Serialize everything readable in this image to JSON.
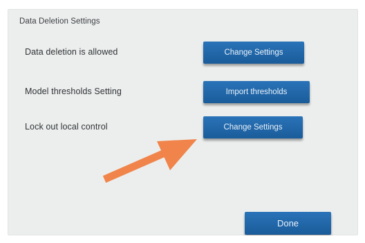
{
  "settings": {
    "title": "Data Deletion Settings",
    "rows": [
      {
        "label": "Data deletion is allowed",
        "button": "Change Settings"
      },
      {
        "label": "Model thresholds Setting",
        "button": "Import thresholds"
      },
      {
        "label": "Lock out local control",
        "button": "Change Settings"
      }
    ]
  },
  "footer": {
    "done_label": "Done"
  },
  "annotation": {
    "arrow_color": "#f0844a",
    "arrow_icon": "arrow-up-right-icon"
  },
  "colors": {
    "accent": "#1f67a8",
    "background": "#eceeee"
  }
}
